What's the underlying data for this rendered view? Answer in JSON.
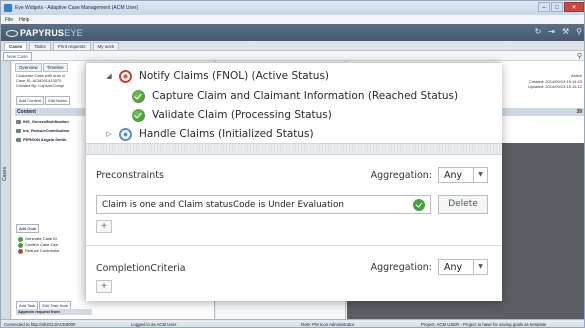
{
  "window": {
    "title": "Eye Widgets - Adaptive Case Management (ACM User)",
    "controls": [
      "–",
      "□",
      "✕"
    ]
  },
  "menu": [
    "File",
    "Help"
  ],
  "app": {
    "logo_main": "PAPYRUS",
    "logo_sub": "EYE",
    "header_icons": [
      "↻",
      "⇥",
      "⚒",
      "⚲"
    ]
  },
  "nav": {
    "tabs": [
      "Cases",
      "Tasks",
      "Print requests",
      "My work"
    ]
  },
  "toolbar": {
    "new_case": "New Case"
  },
  "left": {
    "side_tab": "Cases",
    "subtabs": [
      "Overview",
      "Timeline"
    ],
    "meta": [
      "Customer Case with auto cl",
      "Case ID:  ACM201413070",
      "Created By: CaptureCompl"
    ],
    "buttons": [
      "Add Content",
      "Edit Notes"
    ],
    "content_header": "Content",
    "content_items": [
      "INS_GeneralNotification",
      "Ins_ReduceContribution",
      "PERSON Angela Smith"
    ],
    "add_goal": "Add Goal",
    "goals": [
      "Generate Case ID",
      "Confirm Case Ope",
      "Reduce Contributio"
    ],
    "task_buttons": [
      "Add Task",
      "Edit Task Note"
    ],
    "approve_row": "Approve request from"
  },
  "right": {
    "meta": [
      "Active",
      "Created: 2014/09/13 15:14:43",
      "Updated: 2014/09/13 15:15:12"
    ],
    "count": "39"
  },
  "statusbar": {
    "connected": "Connected to http://ah2014/ACE6000",
    "logged": "Logged in as ACM User",
    "role": "Role: PM Icon Administrator",
    "project": "Project: ACM USER - Project to have for saving goals as template"
  },
  "popup": {
    "tree": [
      {
        "expander": "◢",
        "icon": "red",
        "label": "Notify Claims (FNOL)  (Active Status)"
      },
      {
        "expander": "",
        "icon": "green",
        "label": "Capture Claim and Claimant Information   (Reached Status)"
      },
      {
        "expander": "",
        "icon": "green",
        "label": "Validate Claim   (Processing Status)"
      },
      {
        "expander": "▷",
        "icon": "blue",
        "label": "Handle Claims   (Initialized Status)"
      }
    ],
    "preconstraints": {
      "title": "Preconstraints",
      "aggregation_label": "Aggregation:",
      "aggregation_value": "Any",
      "condition": "Claim is one and Claim statusCode is Under Evaluation",
      "delete_label": "Delete",
      "add_label": "+"
    },
    "completion": {
      "title": "CompletionCriteria",
      "aggregation_label": "Aggregation:",
      "aggregation_value": "Any",
      "add_label": "+"
    }
  }
}
